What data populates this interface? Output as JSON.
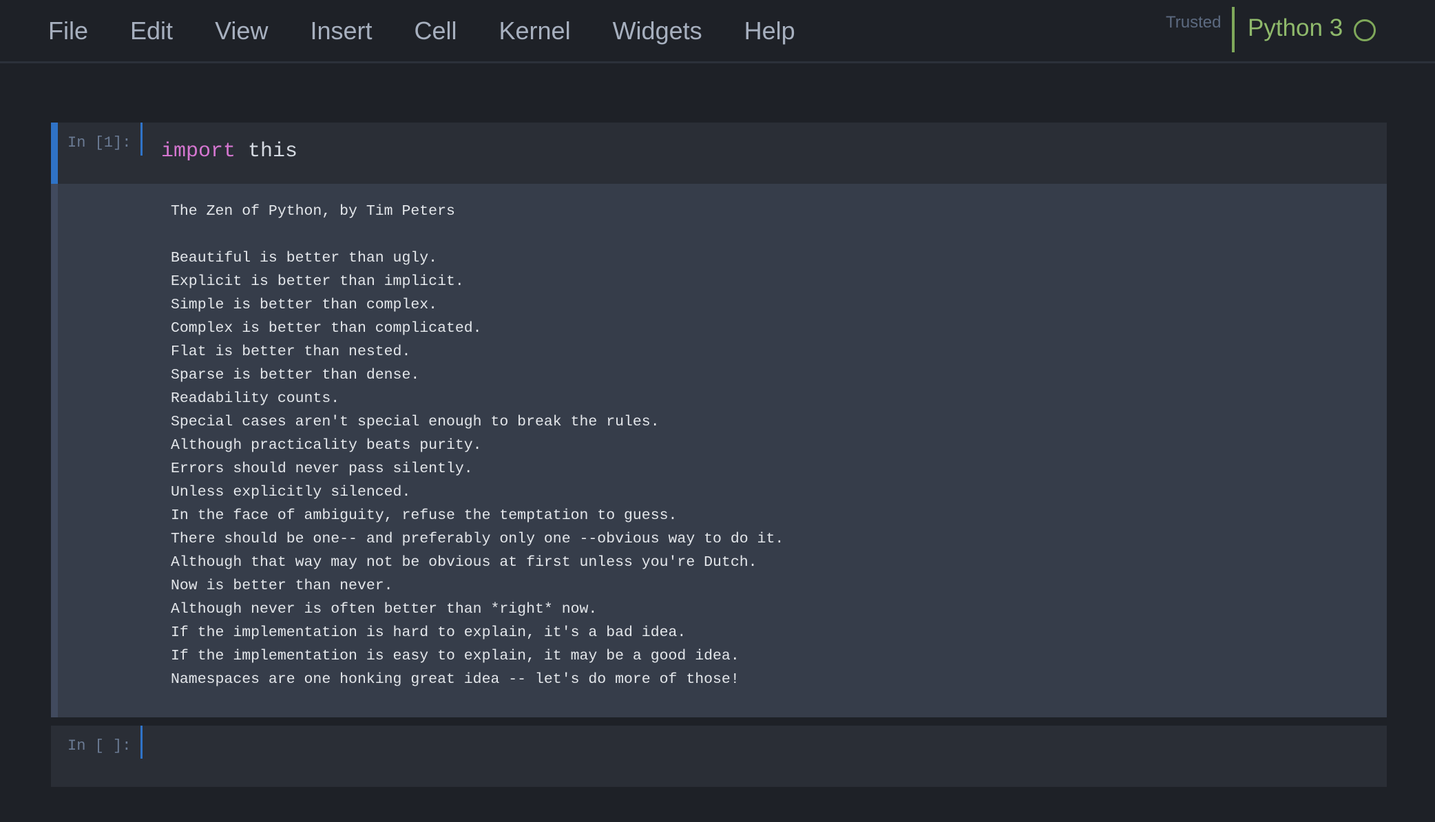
{
  "menubar": {
    "items": [
      {
        "label": "File"
      },
      {
        "label": "Edit"
      },
      {
        "label": "View"
      },
      {
        "label": "Insert"
      },
      {
        "label": "Cell"
      },
      {
        "label": "Kernel"
      },
      {
        "label": "Widgets"
      },
      {
        "label": "Help"
      }
    ],
    "trusted_label": "Trusted",
    "kernel_name": "Python 3"
  },
  "cells": [
    {
      "prompt": "In [1]:",
      "code_keyword": "import",
      "code_rest": " this",
      "output_lines": [
        "The Zen of Python, by Tim Peters",
        "",
        "Beautiful is better than ugly.",
        "Explicit is better than implicit.",
        "Simple is better than complex.",
        "Complex is better than complicated.",
        "Flat is better than nested.",
        "Sparse is better than dense.",
        "Readability counts.",
        "Special cases aren't special enough to break the rules.",
        "Although practicality beats purity.",
        "Errors should never pass silently.",
        "Unless explicitly silenced.",
        "In the face of ambiguity, refuse the temptation to guess.",
        "There should be one-- and preferably only one --obvious way to do it.",
        "Although that way may not be obvious at first unless you're Dutch.",
        "Now is better than never.",
        "Although never is often better than *right* now.",
        "If the implementation is hard to explain, it's a bad idea.",
        "If the implementation is easy to explain, it may be a good idea.",
        "Namespaces are one honking great idea -- let's do more of those!"
      ]
    },
    {
      "prompt": "In [ ]:"
    }
  ],
  "colors": {
    "background": "#1e2127",
    "cell_background": "#2a2e36",
    "output_background": "#363d4a",
    "selection_accent": "#2f73c7",
    "kernel_accent": "#7fa85a",
    "keyword": "#d576d0"
  }
}
